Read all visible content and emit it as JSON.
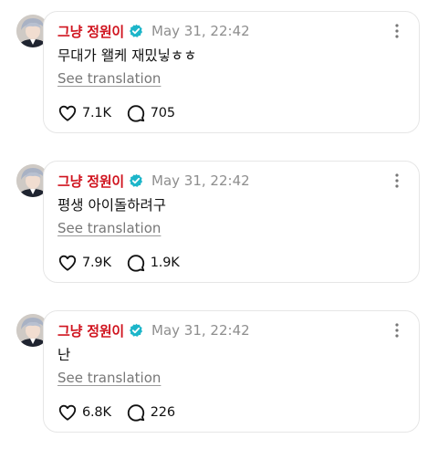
{
  "posts": [
    {
      "author": "그냥 정원이",
      "timestamp": "May 31, 22:42",
      "text": "무대가 왤케 재밌닣ㅎㅎ",
      "translate_label": "See translation",
      "likes": "7.1K",
      "replies": "705"
    },
    {
      "author": "그냥 정원이",
      "timestamp": "May 31, 22:42",
      "text": "평생 아이돌하려구",
      "translate_label": "See translation",
      "likes": "7.9K",
      "replies": "1.9K"
    },
    {
      "author": "그냥 정원이",
      "timestamp": "May 31, 22:42",
      "text": "난",
      "translate_label": "See translation",
      "likes": "6.8K",
      "replies": "226"
    }
  ],
  "icons": {
    "verified": "verified-badge-icon",
    "more": "more-vertical-icon",
    "like": "heart-icon",
    "reply": "reply-bubble-icon"
  },
  "colors": {
    "author": "#d0141f",
    "verified": "#1cb5c9",
    "muted": "#8e8e8e",
    "card_border": "#e6e6e6"
  }
}
